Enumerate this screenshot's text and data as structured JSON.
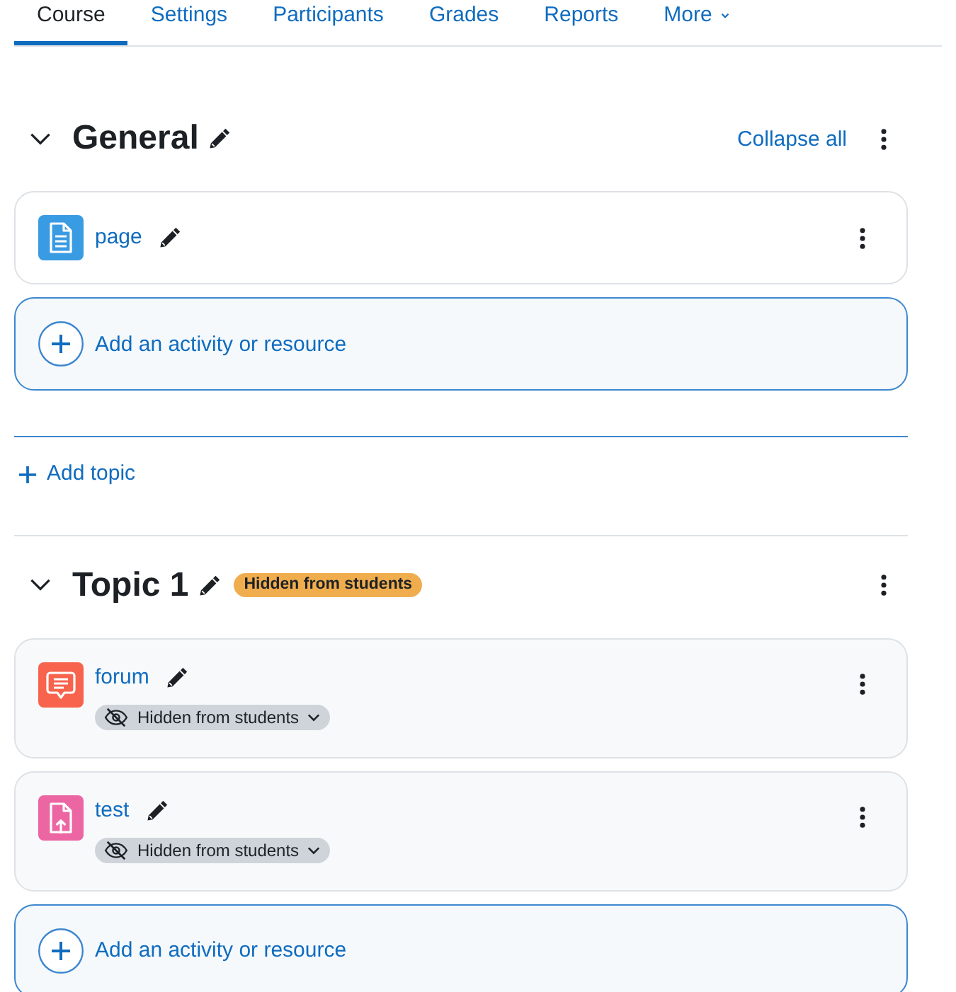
{
  "tabs": [
    {
      "label": "Course",
      "selected": true,
      "kind": "link"
    },
    {
      "label": "Settings",
      "selected": false,
      "kind": "link"
    },
    {
      "label": "Participants",
      "selected": false,
      "kind": "link"
    },
    {
      "label": "Grades",
      "selected": false,
      "kind": "link"
    },
    {
      "label": "Reports",
      "selected": false,
      "kind": "link"
    },
    {
      "label": "More",
      "selected": false,
      "kind": "menu"
    }
  ],
  "sections": [
    {
      "title": "General",
      "expanded": true,
      "collapse_all": "Collapse all",
      "activities": [
        {
          "name": "page",
          "kind": "document",
          "color": "#399be2",
          "hidden": false
        }
      ],
      "add_activity": "Add an activity or resource",
      "add_topic": "Add topic"
    },
    {
      "title": "Topic 1",
      "expanded": true,
      "badge": "Hidden from students",
      "activities": [
        {
          "name": "forum",
          "kind": "chat",
          "color": "#f7634d",
          "hidden": true,
          "visibility": "Hidden from students"
        },
        {
          "name": "test",
          "kind": "upload",
          "color": "#eb66a2",
          "hidden": true,
          "visibility": "Hidden from students"
        }
      ],
      "add_activity": "Add an activity or resource"
    }
  ]
}
